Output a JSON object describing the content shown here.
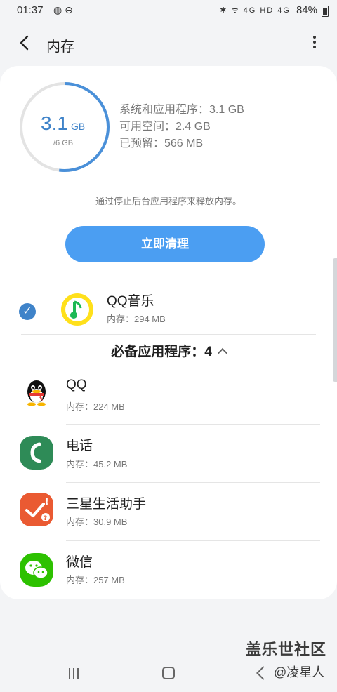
{
  "status_bar": {
    "time": "01:37",
    "left_icons": "◍ ⊖",
    "right_icons": "✱ ᯤ 4G HD 4G",
    "battery": "84%"
  },
  "header": {
    "title": "内存",
    "back_icon": "arrow-back-icon",
    "more_icon": "more-vert-icon"
  },
  "memory": {
    "used_value": "3.1",
    "used_unit": "GB",
    "total": "/6 GB",
    "used_fraction": 0.52,
    "system_apps": "系统和应用程序：3.1 GB",
    "available": "可用空间：2.4 GB",
    "reserved": "已预留：566 MB",
    "ring_color": "#4a90d9"
  },
  "hint": "通过停止后台应用程序来释放内存。",
  "clean_button": "立即清理",
  "selected_app": {
    "name": "QQ音乐",
    "memory": "内存：294 MB",
    "checked": true
  },
  "section_title": "必备应用程序：4",
  "apps": [
    {
      "name": "QQ",
      "memory": "内存：224 MB",
      "icon": "qq-penguin-icon"
    },
    {
      "name": "电话",
      "memory": "内存：45.2 MB",
      "icon": "phone-icon"
    },
    {
      "name": "三星生活助手",
      "memory": "内存：30.9 MB",
      "icon": "samsung-life-assistant-icon"
    },
    {
      "name": "微信",
      "memory": "内存：257 MB",
      "icon": "wechat-icon"
    }
  ],
  "watermark": {
    "line1": "盖乐世社区",
    "line2": "@凌星人"
  }
}
